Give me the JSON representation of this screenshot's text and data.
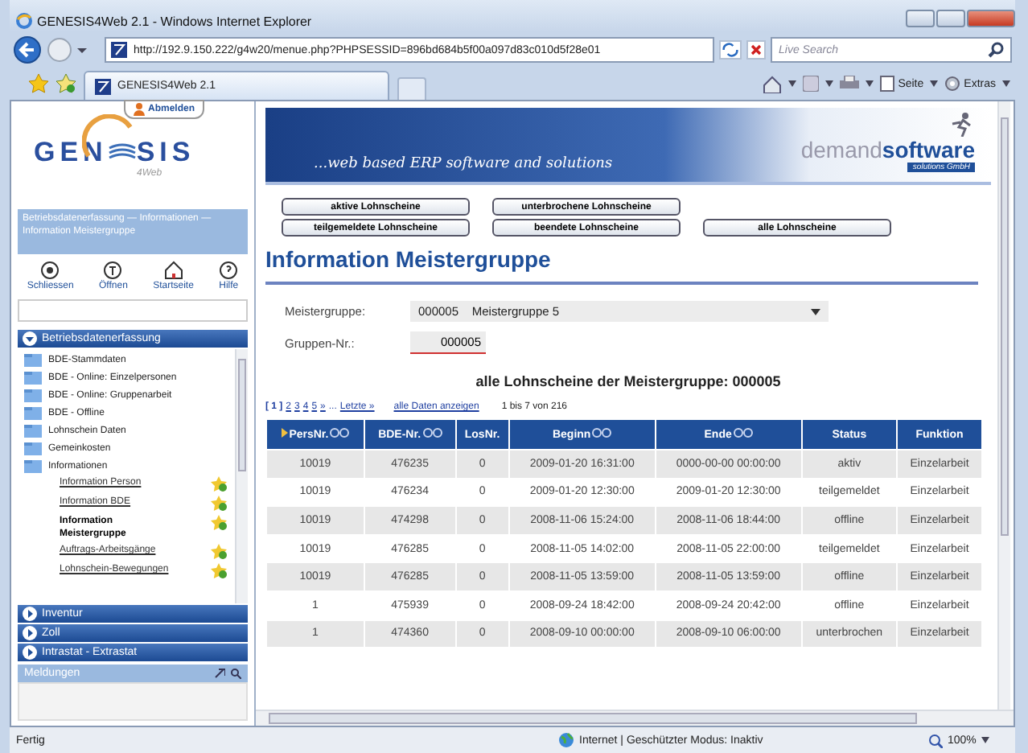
{
  "window": {
    "title": "GENESIS4Web 2.1 - Windows Internet Explorer"
  },
  "browser": {
    "address": "http://192.9.150.222/g4w20/menue.php?PHPSESSID=896bd684b5f00a097d83c010d5f28e01",
    "search_placeholder": "Live Search",
    "tab": "GENESIS4Web 2.1",
    "page_menu": "Seite",
    "tools_menu": "Extras"
  },
  "sidebar": {
    "logout": "Abmelden",
    "logo_left": "GEN",
    "logo_right": "SIS",
    "logo_sub": "4Web",
    "breadcrumb": "Betriebsdatenerfassung — Informationen — Information Meistergruppe",
    "tools": [
      "Schliessen",
      "Öffnen",
      "Startseite",
      "Hilfe"
    ],
    "sections": [
      {
        "label": "Betriebsdatenerfassung",
        "expanded": true,
        "items": [
          {
            "label": "BDE-Stammdaten",
            "selected": false
          },
          {
            "label": "BDE - Online: Einzelpersonen",
            "selected": false
          },
          {
            "label": "BDE - Online: Gruppenarbeit",
            "selected": false
          },
          {
            "label": "BDE - Offline",
            "selected": false
          },
          {
            "label": "Lohnschein Daten",
            "selected": false
          },
          {
            "label": "Gemeinkosten",
            "selected": false
          },
          {
            "label": "Informationen",
            "selected": false,
            "children": [
              {
                "label": "Information Person",
                "selected": false
              },
              {
                "label": "Information BDE",
                "selected": false
              },
              {
                "label": "Information Meistergruppe",
                "selected": true
              },
              {
                "label": "Auftrags-Arbeitsgänge",
                "selected": false
              },
              {
                "label": "Lohnschein-Bewegungen",
                "selected": false
              }
            ]
          }
        ]
      },
      {
        "label": "Inventur",
        "expanded": false
      },
      {
        "label": "Zoll",
        "expanded": false
      },
      {
        "label": "Intrastat - Extrastat",
        "expanded": false
      }
    ],
    "messages_title": "Meldungen"
  },
  "banner": {
    "slogan": "...web based ERP software and solutions",
    "brand_a": "demand",
    "brand_b": "software",
    "brand_sub": "solutions GmbH"
  },
  "filter_buttons": [
    [
      "aktive Lohnscheine",
      "unterbrochene Lohnscheine"
    ],
    [
      "teilgemeldete Lohnscheine",
      "beendete Lohnscheine",
      "alle Lohnscheine"
    ]
  ],
  "heading": "Information Meistergruppe",
  "form": {
    "group_label": "Meistergruppe:",
    "group_value": "000005    Meistergruppe 5",
    "number_label": "Gruppen-Nr.:",
    "number_value": "000005"
  },
  "caption": "alle Lohnscheine der Meistergruppe:  000005",
  "pager": {
    "pages": [
      {
        "label": "[ 1 ]",
        "selected": true
      },
      {
        "label": "2",
        "selected": false
      },
      {
        "label": "3",
        "selected": false
      },
      {
        "label": "4",
        "selected": false
      },
      {
        "label": "5",
        "selected": false
      }
    ],
    "next": "»",
    "ellipsis": "...",
    "last": "Letzte »",
    "show_all": "alle Daten anzeigen",
    "range": "1 bis 7 von 216"
  },
  "table": {
    "columns": [
      {
        "label": "PersNr.",
        "sortable": true,
        "sorted": true
      },
      {
        "label": "BDE-Nr.",
        "sortable": true,
        "sorted": false
      },
      {
        "label": "LosNr.",
        "sortable": false,
        "sorted": false
      },
      {
        "label": "Beginn",
        "sortable": true,
        "sorted": false
      },
      {
        "label": "Ende",
        "sortable": true,
        "sorted": false
      },
      {
        "label": "Status",
        "sortable": false,
        "sorted": false
      },
      {
        "label": "Funktion",
        "sortable": false,
        "sorted": false
      }
    ],
    "rows": [
      [
        "10019",
        "476235",
        "0",
        "2009-01-20 16:31:00",
        "0000-00-00 00:00:00",
        "aktiv",
        "Einzelarbeit"
      ],
      [
        "10019",
        "476234",
        "0",
        "2009-01-20 12:30:00",
        "2009-01-20 12:30:00",
        "teilgemeldet",
        "Einzelarbeit"
      ],
      [
        "10019",
        "474298",
        "0",
        "2008-11-06 15:24:00",
        "2008-11-06 18:44:00",
        "offline",
        "Einzelarbeit"
      ],
      [
        "10019",
        "476285",
        "0",
        "2008-11-05 14:02:00",
        "2008-11-05 22:00:00",
        "teilgemeldet",
        "Einzelarbeit"
      ],
      [
        "10019",
        "476285",
        "0",
        "2008-11-05 13:59:00",
        "2008-11-05 13:59:00",
        "offline",
        "Einzelarbeit"
      ],
      [
        "1",
        "475939",
        "0",
        "2008-09-24 18:42:00",
        "2008-09-24 20:42:00",
        "offline",
        "Einzelarbeit"
      ],
      [
        "1",
        "474360",
        "0",
        "2008-09-10 00:00:00",
        "2008-09-10 06:00:00",
        "unterbrochen",
        "Einzelarbeit"
      ]
    ]
  },
  "status_bar": {
    "text": "Fertig",
    "zone": "Internet | Geschützter Modus: Inaktiv",
    "zoom": "100%"
  }
}
